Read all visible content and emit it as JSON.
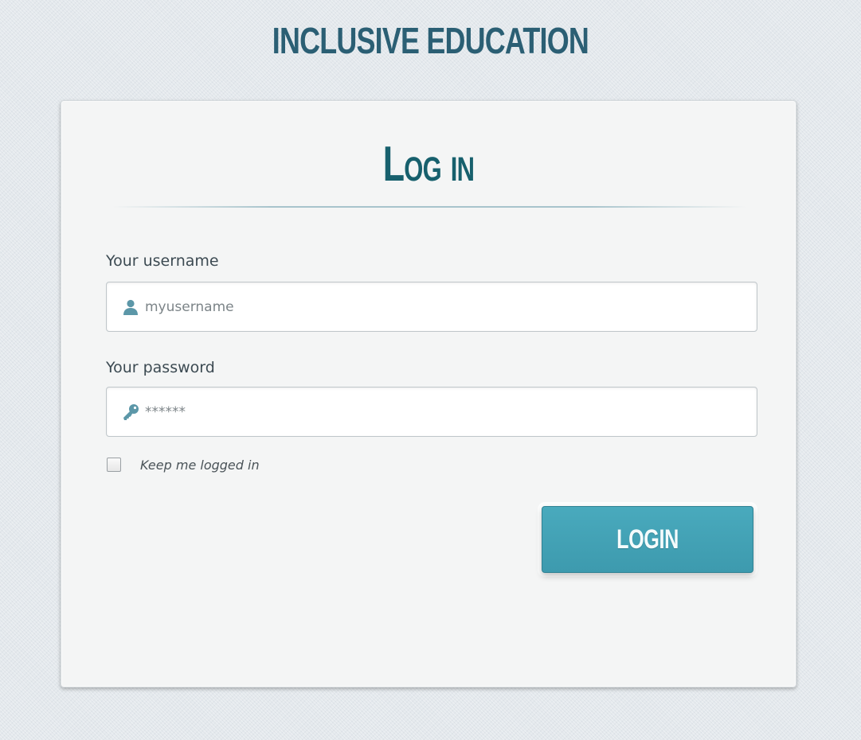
{
  "site": {
    "title": "INCLUSIVE EDUCATION"
  },
  "login_form": {
    "heading": "Log in",
    "username": {
      "label": "Your username",
      "placeholder": "myusername",
      "icon": "user-icon"
    },
    "password": {
      "label": "Your password",
      "placeholder": "******",
      "icon": "key-icon"
    },
    "remember_me": {
      "label": "Keep me logged in",
      "checked": false
    },
    "submit_label": "LOGIN"
  },
  "colors": {
    "title": "#2b5f74",
    "heading": "#17606d",
    "button": "#45a4b8",
    "icon": "#5c97a8",
    "background": "#e3e8ec",
    "card": "#f4f5f5"
  }
}
